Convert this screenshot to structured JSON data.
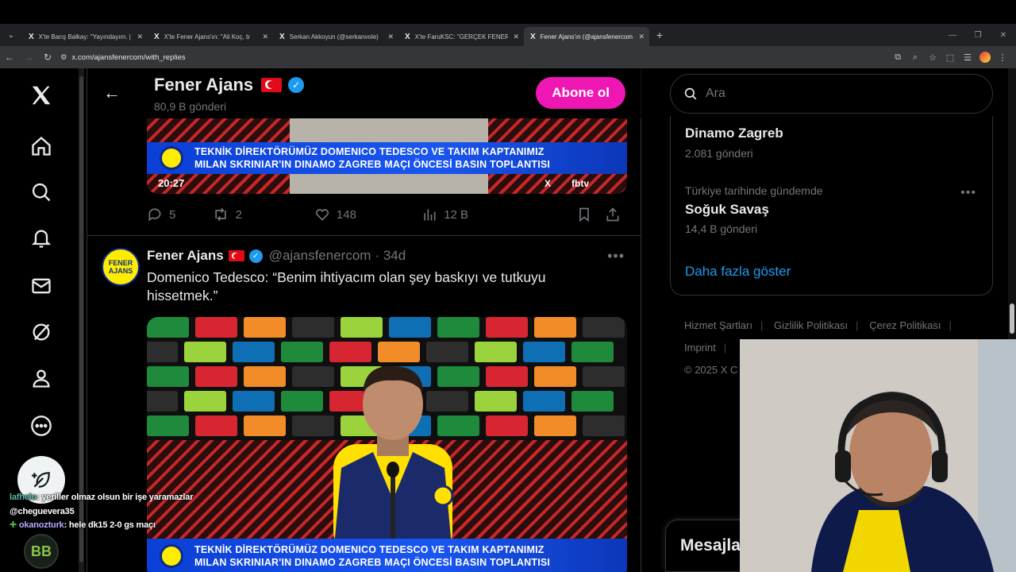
{
  "browser": {
    "tabs": [
      {
        "title": "X'te Barış Balkay: \"Yayındayım. |",
        "active": false
      },
      {
        "title": "X'te Fener Ajans'ın: \"Ali Koç, b",
        "active": false
      },
      {
        "title": "Serkan Akkoyun (@serkanvole)",
        "active": false
      },
      {
        "title": "X'te FaruKSC: \"GERÇEK FENERE",
        "active": false
      },
      {
        "title": "Fener Ajans'ın (@ajansfenercom",
        "active": true
      }
    ],
    "url": "x.com/ajansfenercom/with_replies"
  },
  "profile_header": {
    "name": "Fener Ajans",
    "post_count": "80,9 B gönderi",
    "subscribe_label": "Abone ol"
  },
  "tweet1": {
    "banner_line1": "TEKNİK DİREKTÖRÜMÜZ DOMENICO TEDESCO VE TAKIM KAPTANIMIZ",
    "banner_line2": "MILAN SKRINIAR'IN DINAMO ZAGREB MAÇI ÖNCESİ BASIN TOPLANTISI",
    "video_time": "20:27",
    "channel": "fbtv",
    "replies": "5",
    "retweets": "2",
    "likes": "148",
    "views": "12 B"
  },
  "tweet2": {
    "name": "Fener Ajans",
    "handle": "@ajansfenercom",
    "time": "· 34d",
    "avatar_text": "FENER AJANS",
    "text": "Domenico Tedesco: “Benim ihtiyacım olan şey baskıyı ve tutkuyu hissetmek.”",
    "banner_line1": "TEKNİK DİREKTÖRÜMÜZ DOMENICO TEDESCO VE TAKIM KAPTANIMIZ",
    "banner_line2": "MILAN SKRINIAR'IN DINAMO ZAGREB MAÇI ÖNCESİ BASIN TOPLANTISI"
  },
  "search": {
    "placeholder": "Ara"
  },
  "trends": [
    {
      "context": "",
      "title": "Dinamo Zagreb",
      "count": "2.081 gönderi"
    },
    {
      "context": "Türkiye tarihinde gündemde",
      "title": "Soğuk Savaş",
      "count": "14,4 B gönderi"
    }
  ],
  "show_more": "Daha fazla göster",
  "footer": {
    "links": [
      "Hizmet Şartları",
      "Gizlilik Politikası",
      "Çerez Politikası",
      "Imprint"
    ],
    "copyright": "© 2025 X C"
  },
  "messages": {
    "title": "Mesajlar"
  },
  "stream_chat": [
    {
      "user": "lafhelo",
      "text": ": yeriller olmaz olsun bir işe yaramazlar"
    },
    {
      "user": "",
      "text": "@cheguevera35"
    },
    {
      "user": "okanozturk",
      "text": ": hele dk15 2-0 gs maçı"
    }
  ],
  "overlay_logo": "BB"
}
